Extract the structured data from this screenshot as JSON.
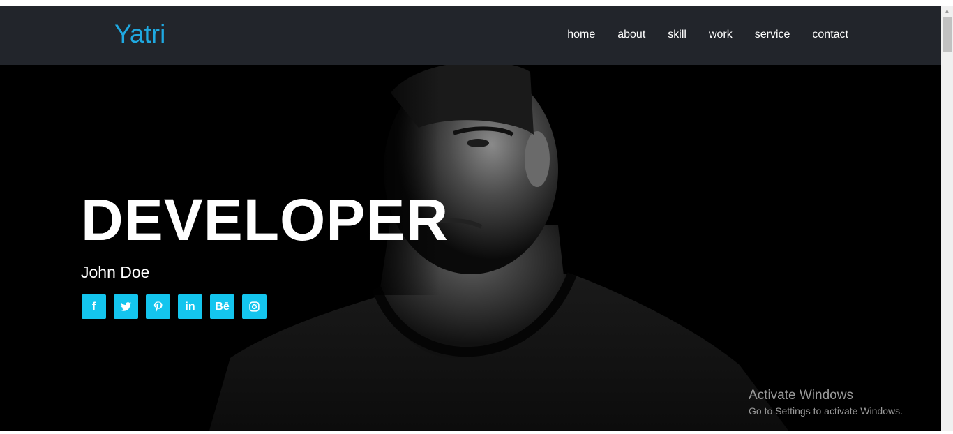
{
  "navbar": {
    "brand": "Yatri",
    "links": [
      "home",
      "about",
      "skill",
      "work",
      "service",
      "contact"
    ]
  },
  "hero": {
    "title": "DEVELOPER",
    "name": "John Doe",
    "social": [
      {
        "label": "f",
        "icon": "facebook-icon"
      },
      {
        "label": "",
        "icon": "twitter-icon"
      },
      {
        "label": "",
        "icon": "pinterest-icon"
      },
      {
        "label": "in",
        "icon": "linkedin-icon"
      },
      {
        "label": "Bē",
        "icon": "behance-icon"
      },
      {
        "label": "",
        "icon": "instagram-icon"
      }
    ]
  },
  "watermark": {
    "title": "Activate Windows",
    "subtitle": "Go to Settings to activate Windows."
  },
  "colors": {
    "nav_bg": "#22252b",
    "brand": "#1fa9e1",
    "social_bg": "#14c5ee",
    "hero_bg": "#000000"
  }
}
